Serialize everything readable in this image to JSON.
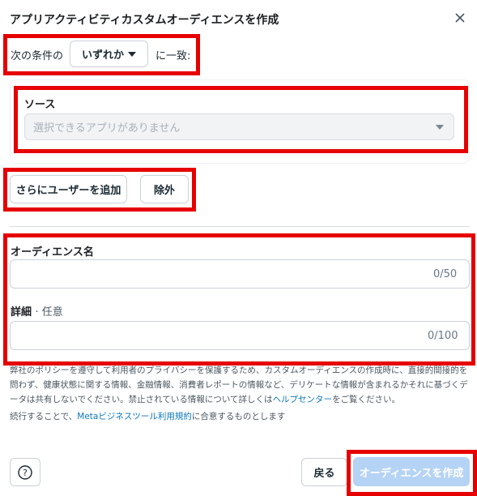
{
  "dialog": {
    "title": "アプリアクティビティカスタムオーディエンスを作成"
  },
  "condition": {
    "prefix": "次の条件の",
    "match_value": "いずれか",
    "suffix": "に一致:"
  },
  "source": {
    "label": "ソース",
    "placeholder": "選択できるアプリがありません"
  },
  "actions": {
    "add_users": "さらにユーザーを追加",
    "exclude": "除外"
  },
  "audience_name": {
    "label": "オーディエンス名",
    "counter": "0/50"
  },
  "details": {
    "label": "詳細",
    "optional": "· 任意",
    "counter": "0/100"
  },
  "policy": {
    "text_before": "弊社のポリシーを遵守して利用者のプライバシーを保護するため、カスタムオーディエンスの作成時に、直接的間接的を問わず、健康状態に関する情報、金融情報、消費者レポートの情報など、デリケートな情報が含まれるかそれに基づくデータは共有しないでください。禁止されている情報について詳しくは",
    "link": "ヘルプセンター",
    "text_after": "をご覧ください。"
  },
  "terms": {
    "before": "続行することで、",
    "link": "Metaビジネスツール利用規約",
    "after": "に合意するものとします"
  },
  "footer": {
    "help_symbol": "?",
    "back": "戻る",
    "create": "オーディエンスを作成"
  },
  "colors": {
    "highlight": "#e60000",
    "primary_disabled": "#b5d3f4",
    "link": "#0a78be"
  }
}
